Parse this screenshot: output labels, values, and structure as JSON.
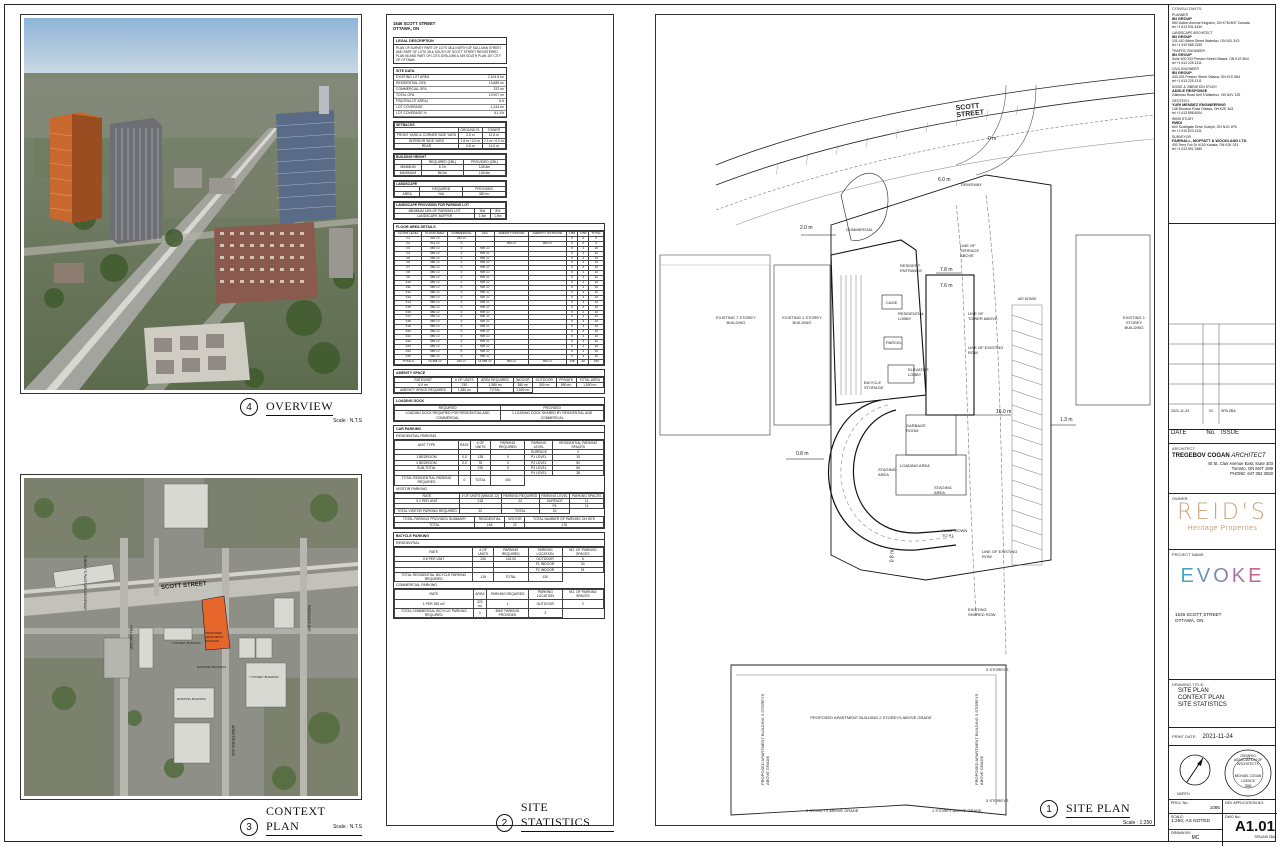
{
  "overview": {
    "number": "4",
    "title": "OVERVIEW",
    "scale": "Scale : N.T.S"
  },
  "context_plan": {
    "number": "3",
    "title": "CONTEXT PLAN",
    "scale": "Scale : N.T.S",
    "street_label": "SCOTT STREET",
    "street_side_1": "TUNNEY'S PASTURE DRIVEWAY",
    "street_side_2": "HOLLAND AVE",
    "street_side_3": "PARKDALE AVE",
    "street_side_4": "ARMSTRONG AVE",
    "building_labels": [
      "7 STOREY BUILDING",
      "PROPOSED APARTMENT BUILDING",
      "EXISTING BUILDING",
      "7 STOREY BUILDING",
      "EXISTING BUILDING"
    ]
  },
  "site_statistics": {
    "number": "2",
    "title": "SITE STATISTICS",
    "address_line1": "1546 SCOTT STREET",
    "address_line2": "OTTAWA, ON",
    "legal_head": "LEGAL DESCRIPTION",
    "legal_text": "PLAN OF SURVEY PART OF LOTS 38 & NORTH OF SULLIVAN STREET AND PART OF LOTS 38 & SOUTH OF SCOTT STREET REGISTERED PLAN 56 AND PART OF LOTS 1095-1096 & 169 SOUTH PLAN 157 CITY OF OTTAWA",
    "site_data_head": "SITE DATA",
    "site_data": [
      [
        "EXISTING LOT AREA",
        "2,104.5 m²"
      ],
      [
        "RESIDENTIAL GFA",
        "13,685 m²"
      ],
      [
        "COMMERCIAL GFA",
        "222 m²"
      ],
      [
        "TOTAL GFA",
        "13,907 m²"
      ],
      [
        "FSI(GFA/LOT AREA)",
        "6.6"
      ],
      [
        "LOT COVERAGE",
        "1,244 m²"
      ],
      [
        "LOT COVERAGE %",
        "61.1%"
      ]
    ],
    "setbacks_head": "SETBACKS",
    "setbacks_cols": [
      "",
      "GROUND FL",
      "TOWER"
    ],
    "setbacks": [
      [
        "FRONT YARD & CORNER SIDE YARD",
        "2.0 m",
        "12.8 m"
      ],
      [
        "INTERIOR SIDE YARD",
        "7.8 m / 0.0 m",
        "7.1 m / 0.0 m"
      ],
      [
        "REAR",
        "0.8 m",
        "11.6 m"
      ]
    ],
    "height_head": "BUILDING HEIGHT",
    "height_cols": [
      "",
      "REQUIRED (ZBL)",
      "PROVIDED (ZBL)"
    ],
    "height": [
      [
        "MINIMUM",
        "6.7m",
        "145.6m"
      ],
      [
        "MAXIMUM",
        "86.0m",
        "145.6m"
      ]
    ],
    "landscape_head": "LANDSCAPE",
    "landscape_cols": [
      "",
      "REQUIRED",
      "PROVIDED"
    ],
    "landscape": [
      [
        "AREA",
        "N/A",
        "380 m²"
      ]
    ],
    "landscape_park_head": "LANDSCAPE PROVISION FOR PARKING LOT",
    "landscape_park": [
      [
        "MINIMUM 15% OF PARKING LOT",
        "N/A",
        "8%"
      ],
      [
        "LANDSCAPE BUFFER",
        "1.5m",
        "1.5m"
      ]
    ],
    "floor_head": "FLOOR AREA DETAILS",
    "floor_cols": [
      "FLOOR LEVEL",
      "FLOOR AREA",
      "COMMERCIAL",
      "GFA",
      "AMENITY INDOOR",
      "AMENITY OUTDOOR",
      "1 BR",
      "2 BR",
      "TOTAL"
    ],
    "floors": [
      [
        "F1",
        "222 m²",
        "222 m²",
        "",
        "",
        "",
        "0",
        "0",
        "0"
      ],
      [
        "F2",
        "511 m²",
        "0",
        "",
        "350 m²",
        "300 m²",
        "0",
        "0",
        "0"
      ],
      [
        "F3",
        "680 m²",
        "0",
        "505 m²",
        "",
        "",
        "6",
        "4",
        "10"
      ],
      [
        "F4",
        "680 m²",
        "0",
        "505 m²",
        "",
        "",
        "6",
        "4",
        "10"
      ],
      [
        "F5",
        "680 m²",
        "0",
        "505 m²",
        "",
        "",
        "6",
        "4",
        "10"
      ],
      [
        "F6",
        "680 m²",
        "0",
        "505 m²",
        "",
        "",
        "6",
        "4",
        "10"
      ],
      [
        "F7",
        "680 m²",
        "0",
        "505 m²",
        "",
        "",
        "6",
        "4",
        "10"
      ],
      [
        "F8",
        "680 m²",
        "0",
        "505 m²",
        "",
        "",
        "6",
        "4",
        "10"
      ],
      [
        "F9",
        "680 m²",
        "0",
        "505 m²",
        "",
        "",
        "6",
        "4",
        "10"
      ],
      [
        "F10",
        "680 m²",
        "0",
        "505 m²",
        "",
        "",
        "6",
        "4",
        "10"
      ],
      [
        "F11",
        "680 m²",
        "0",
        "505 m²",
        "",
        "",
        "6",
        "4",
        "10"
      ],
      [
        "F12",
        "680 m²",
        "0",
        "505 m²",
        "",
        "",
        "6",
        "4",
        "10"
      ],
      [
        "F13",
        "680 m²",
        "0",
        "505 m²",
        "",
        "",
        "6",
        "4",
        "10"
      ],
      [
        "F14",
        "680 m²",
        "0",
        "505 m²",
        "",
        "",
        "6",
        "4",
        "10"
      ],
      [
        "F15",
        "680 m²",
        "0",
        "505 m²",
        "",
        "",
        "6",
        "4",
        "10"
      ],
      [
        "F16",
        "680 m²",
        "0",
        "505 m²",
        "",
        "",
        "6",
        "4",
        "10"
      ],
      [
        "F17",
        "680 m²",
        "0",
        "505 m²",
        "",
        "",
        "6",
        "4",
        "10"
      ],
      [
        "F18",
        "680 m²",
        "0",
        "505 m²",
        "",
        "",
        "6",
        "4",
        "10"
      ],
      [
        "F19",
        "680 m²",
        "0",
        "505 m²",
        "",
        "",
        "6",
        "4",
        "10"
      ],
      [
        "F20",
        "680 m²",
        "0",
        "505 m²",
        "",
        "",
        "6",
        "4",
        "10"
      ],
      [
        "F21",
        "680 m²",
        "0",
        "505 m²",
        "",
        "",
        "6",
        "4",
        "10"
      ],
      [
        "F22",
        "680 m²",
        "0",
        "505 m²",
        "",
        "",
        "6",
        "4",
        "10"
      ],
      [
        "F23",
        "680 m²",
        "0",
        "505 m²",
        "",
        "",
        "6",
        "4",
        "10"
      ],
      [
        "F24",
        "680 m²",
        "0",
        "505 m²",
        "",
        "",
        "6",
        "4",
        "10"
      ],
      [
        "F25",
        "680 m²",
        "0",
        "505 m²",
        "",
        "",
        "6",
        "4",
        "10"
      ],
      [
        "TOTALS",
        "16,368 m²",
        "222 m²",
        "13,685 m²",
        "350 m²",
        "300 m²",
        "138",
        "92",
        "230"
      ]
    ],
    "amenity_head": "AMENITY SPACE",
    "amenity_cols": [
      "RATE/UNIT",
      "# OF UNITS",
      "AREA REQUIRED",
      "INDOOR",
      "OUTDOOR",
      "PRIVATE",
      "TOTAL AREA"
    ],
    "amenity": [
      [
        "6.0 m²",
        "230",
        "1,380 m²",
        "350 m²",
        "300 m²",
        "850 m²",
        "1,500 m²"
      ]
    ],
    "amenity_total": [
      "AMENITY SPACE REQUIRED",
      "1,380 m²",
      "TOTAL",
      "1,500 m²"
    ],
    "loading_head": "LOADING DOCK",
    "loading_cols": [
      "REQUIRED",
      "PROVIDED"
    ],
    "loading": [
      [
        "LOADING DOCK REQUIRED FOR RESIDENTIAL AND COMMERCIAL",
        "1 LOADING DOCK SHARED BY RESIDENTIAL AND COMMERCIAL"
      ]
    ],
    "car_head": "CAR PARKING",
    "car_res_head": "RESIDENTIAL PARKING",
    "car_res_cols": [
      "UNIT TYPE",
      "RATE",
      "# OF UNITS",
      "PARKING REQUIRED",
      "PARKING LEVEL",
      "RESIDENTIAL PARKING SPACES"
    ],
    "car_res": [
      [
        "",
        "",
        "",
        "",
        "SURFACE",
        "0"
      ],
      [
        "1 BEDROOM",
        "0.0",
        "138",
        "0",
        "P1 LEVEL",
        "10"
      ],
      [
        "2 BEDROOM",
        "0.0",
        "92",
        "0",
        "P2 LEVEL",
        "50"
      ],
      [
        "SUB-TOTAL",
        "",
        "230",
        "0",
        "P3 LEVEL",
        "56"
      ],
      [
        "",
        "",
        "",
        "",
        "P4 LEVEL",
        "38"
      ]
    ],
    "car_res_total": [
      "TOTAL RESIDENTIAL PARKING REQUIRED",
      "0",
      "TOTAL",
      "154"
    ],
    "visitor_head": "VISITOR PARKING",
    "visitor_cols": [
      "RATE",
      "# OF UNITS (MINUS 12)",
      "PARKING REQUIRED",
      "PARKING LEVEL",
      "PARKING SPACES"
    ],
    "visitor": [
      [
        "0.1 PER UNIT",
        "218",
        "22",
        "SURFACE",
        "11"
      ],
      [
        "",
        "",
        "",
        "P1",
        "11"
      ]
    ],
    "visitor_total": [
      "TOTAL VISITOR PARKING REQUIRED",
      "22",
      "TOTAL",
      "22"
    ],
    "parking_summary": [
      [
        "TOTAL PARKING PROVIDED SUMMARY",
        "RESIDENTIAL",
        "VISITOR",
        "TOTAL NUMBER OF PARKING ON SITE"
      ],
      [
        "TOTAL",
        "154",
        "22",
        "176"
      ]
    ],
    "bike_head": "BICYCLE PARKING",
    "bike_res_head": "RESIDENTIAL",
    "bike_res_cols": [
      "RATE",
      "# OF UNITS",
      "PARKING REQUIRED",
      "PARKING LOCATION",
      "NO. OF PARKING SPACES"
    ],
    "bike_res": [
      [
        "0.5 PER UNIT",
        "230",
        "115.00",
        "OUTDOOR",
        "5"
      ],
      [
        "",
        "",
        "",
        "F1 INDOOR",
        "34"
      ],
      [
        "",
        "",
        "",
        "F2 INDOOR",
        "91"
      ]
    ],
    "bike_res_total": [
      "TOTAL RESIDENTIAL BICYCLE PARKING REQUIRED",
      "115",
      "TOTAL",
      "130"
    ],
    "bike_com_head": "COMMERCIAL PARKING",
    "bike_com_cols": [
      "RATE",
      "AREA",
      "PARKING REQUIRED",
      "PARKING LOCATION",
      "NO. OF PARKING SPACES"
    ],
    "bike_com": [
      [
        "1 PER 250 m2",
        "222 m²",
        "1",
        "OUTDOOR",
        "2"
      ]
    ],
    "bike_com_total": [
      "TOTAL COMMERCIAL BICYCLE PARKING REQUIRED",
      "1",
      "BIKE PARKING PROVIDED",
      "2"
    ]
  },
  "site_plan": {
    "number": "1",
    "title": "SITE PLAN",
    "scale": "Scale : 1:250",
    "street": "SCOTT STREET",
    "labels": {
      "commercial": "COMMERCIAL",
      "driveway": "DRIVEWAY",
      "existing_7": "EXISTING 7 STOREY BUILDING",
      "existing_1": "EXISTING 1 STOREY BUILDING",
      "existing_1_right": "EXISTING 1 STOREY BUILDING",
      "res_lobby": "RESIDENTIAL LOBBY",
      "res_entrance": "RESIDENT ENTRANCE",
      "bicycle": "BICYCLE STORAGE",
      "elevator": "ELEVATOR LOBBY",
      "garbage": "GARBAGE ROOM",
      "loading": "LOADING AREA",
      "staging": "STAGING AREA",
      "staging2": "STAGING AREA",
      "ramp": "RAMP DOWN TO P1",
      "line_terrace": "LINE OF TERRACE ABOVE",
      "line_tower": "LINE OF TOWER ABOVE",
      "line_row": "LINE OF EXISTING ROW",
      "shared_row": "EXISTING SHARED ROW",
      "proposed_bldg": "PROPOSED APARTMENT BUILDING 2 STOREYS ABOVE GRADE",
      "proposed_bldg_v1": "PROPOSED APARTMENT BUILDING 3 STOREYS ABOVE GRADE",
      "proposed_bldg_v2": "PROPOSED APARTMENT BUILDING 3 STOREYS ABOVE GRADE",
      "above_grade_1": "3 STOREYS ABOVE GRADE",
      "above_grade_2": "1 STOREY ABOVE GRADE",
      "above_grade_3": "3 STOREYS",
      "above_grade_4": "3 STOREYS",
      "cage": "CAGE",
      "parcel": "PARCEL",
      "dim_2m": "2.0 m",
      "dim_6m": "6.0 m",
      "dim_78": "7.8 m",
      "dim_76": "7.6 m",
      "dim_16": "16.0 m",
      "dim_13": "1.3 m",
      "dim_08": "0.8 m",
      "dim_08b": "0.8 m",
      "dim_0": "0 m",
      "air_intake": "AIR INTAKE"
    }
  },
  "title_block": {
    "consultants_head": "CONSULTANTS:",
    "consultants": [
      {
        "role": "PLANNER",
        "firm": "IBI GROUP",
        "addr": "650 Dalton Avenue Kingston, ON K7M 8N7 Canada",
        "tel": "tel +1 613 531 4440"
      },
      {
        "role": "LANDSCAPE ARCHITECT",
        "firm": "IBI GROUP",
        "addr": "101-410 Albert Street Waterloo, ON N2L 3V3",
        "tel": "tel +1 519 585 2255"
      },
      {
        "role": "TRAFFIC ENGINEER",
        "firm": "IBI GROUP",
        "addr": "Suite 400 333 Preston Street Ottawa, ON K1S 5N4",
        "tel": "tel +1 613 225 1311"
      },
      {
        "role": "CIVIL ENGINEER",
        "firm": "IBI GROUP",
        "addr": "400-333 Preston Street Ottawa, ON K1S 5N4",
        "tel": "tel +1 613 225 1311"
      },
      {
        "role": "NOISE & VIBRATION STUDY",
        "firm": "ADDLE RESPONSE",
        "addr": "Gatineau Road Unit 5 Waterloo, ON N2V 1Z5",
        "tel": ""
      },
      {
        "role": "GEOTECH",
        "firm": "YURI MENDEZ ENGINEERING",
        "addr": "148 Bronson Road Ottawa, ON K2E 3A3",
        "tel": "tel +1 613 898 8004"
      },
      {
        "role": "WIND STUDY",
        "firm": "RWDI",
        "addr": "600 Southgate Drive Guelph, ON N1G 4P6",
        "tel": "tel +1 519 823 1311"
      },
      {
        "role": "SURVEYOR",
        "firm": "FAIRHALL, MOFFATT & WOODLAND LTD.",
        "addr": "400 Terry Fox Dr #100 Kanata, ON K2K 0J3",
        "tel": "tel +1 613 591 2580"
      }
    ],
    "issue_row": [
      "2021-11-24",
      "01",
      "SPA ZBA"
    ],
    "issue_cols": [
      "DATE",
      "No.",
      "ISSUE"
    ],
    "architect_label": "ARCHITECT:",
    "architect_name": "TREGEBOV COGAN",
    "architect_suffix": "ARCHITECT",
    "architect_addr1": "40 St. Clair Avenue East, Suite 303",
    "architect_addr2": "Toronto, ON   M4T 1M9",
    "architect_phone": "PHONE: 647 352 3550",
    "owner_label": "OWNER:",
    "owner_logo": "REID'S",
    "owner_logo_sub": "Heritage Properties",
    "project_label": "PROJECT NAME:",
    "project_logo": "EVOKE",
    "project_addr1": "1546 SCOTT STREET",
    "project_addr2": "OTTAWA, ON",
    "drawing_label": "DRAWING TITLE:",
    "drawing_titles": [
      "SITE PLAN",
      "CONTEXT PLAN",
      "SITE STATISTICS"
    ],
    "print_label": "PRINT DATE:",
    "print_date": "2021-11-24",
    "north": "NORTH",
    "seal_outer": "ONTARIO ASSOCIATION OF ARCHITECTS",
    "seal_name": "MICHAEL COGAN",
    "seal_licence": "LICENCE",
    "seal_no": "7884",
    "proj_no_label": "PROJ. No.:",
    "proj_no": "1085",
    "dev_app_label": "DEV APPLICATION NO:",
    "scale_label": "SCALE:",
    "scale": "1:250,  AS NOTED",
    "dwg_label": "DWG No.:",
    "dwg_no": "A1.01",
    "drawn_label": "DRAWN BY:",
    "drawn": "MC",
    "sub_note": "SPA AND ZBA"
  },
  "colors": {
    "proposed": "#e5652a",
    "owner_logo": "#c9a27a",
    "project_logo_a": "#2bb3c9",
    "project_logo_b": "#e8508b"
  }
}
